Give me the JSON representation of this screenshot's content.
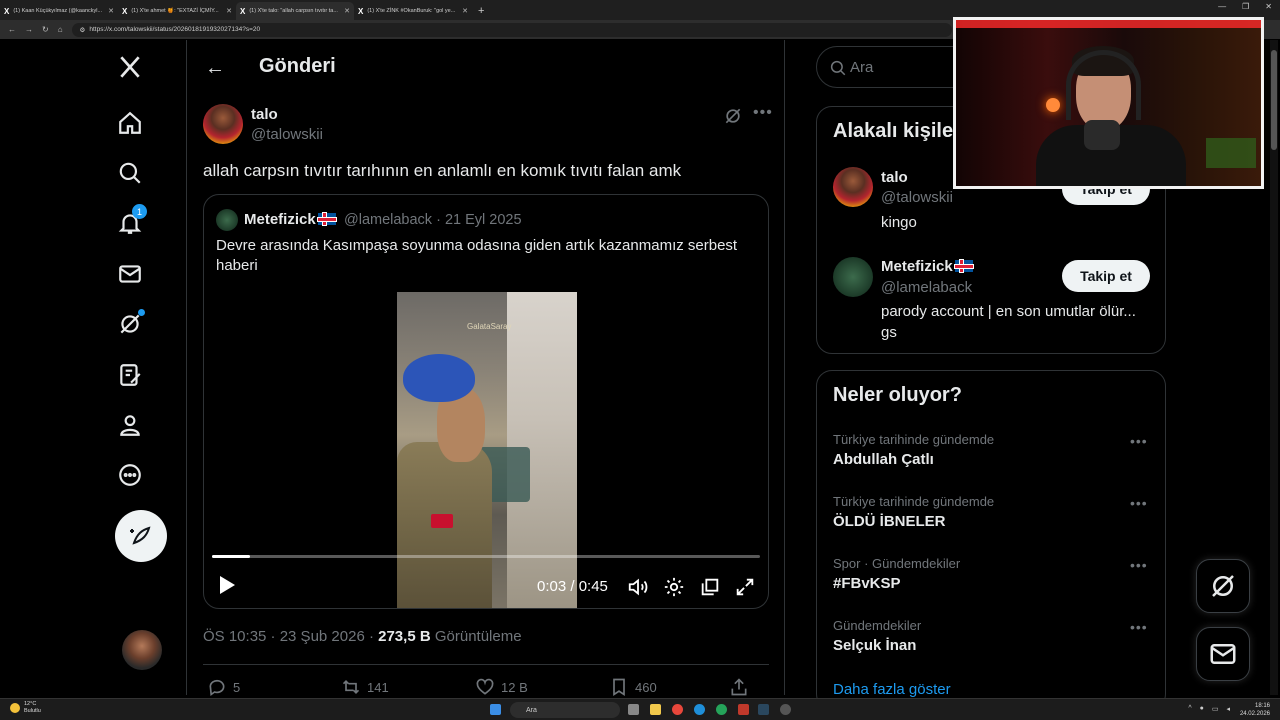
{
  "browser": {
    "tabs": [
      {
        "label": "(1) Kaan Küçükyılmaz (@kaanckyl...",
        "active": false
      },
      {
        "label": "(1) X'te ahmet 🍯: \"EXTAZİ İÇMİY...",
        "active": false
      },
      {
        "label": "(1) X'te talo: \"allah carpsın tıvıtır ta...",
        "active": true
      },
      {
        "label": "(1) X'te ZİNK #OkanBuruk: \"gol ye...",
        "active": false
      }
    ],
    "new_tab": "+",
    "url": "https://x.com/talowskii/status/2026018191932027134?s=20"
  },
  "nav": {
    "notifications_count": "1"
  },
  "header": {
    "back": "←",
    "title": "Gönderi"
  },
  "post": {
    "author_name": "talo",
    "author_handle": "@talowskii",
    "text": "allah carpsın tıvıtır tarıhının en anlamlı en komık tıvıtı falan amk",
    "timestamp": "ÖS 10:35 · 23 Şub 2026 ·",
    "views": "273,5 B",
    "views_label": "Görüntüleme",
    "replies": "5",
    "reposts": "141",
    "likes": "12 B",
    "bookmarks": "460"
  },
  "quote": {
    "author_name": "Metefizick",
    "author_handle": "@lamelaback · 21 Eyl 2025",
    "text": "Devre arasında Kasımpaşa soyunma odasına giden artık kazanmamız serbest haberi",
    "video_time": "0:03 / 0:45",
    "video_progress": 0.07,
    "video_sign": "GalataSaray"
  },
  "sidebar": {
    "search_placeholder": "Ara",
    "related_title": "Alakalı kişiler",
    "related": [
      {
        "name": "talo",
        "handle": "@talowskii",
        "bio": "kingo",
        "follow": "Takip et"
      },
      {
        "name": "Metefizick",
        "handle": "@lamelaback",
        "bio": "parody account | en son umutlar ölür... gs",
        "follow": "Takip et"
      }
    ],
    "trends_title": "Neler oluyor?",
    "trends": [
      {
        "context": "Türkiye tarihinde gündemde",
        "name": "Abdullah Çatlı"
      },
      {
        "context": "Türkiye tarihinde gündemde",
        "name": "ÖLDÜ İBNELER"
      },
      {
        "context": "Spor · Gündemdekiler",
        "name": "#FBvKSP"
      },
      {
        "context": "Gündemdekiler",
        "name": "Selçuk İnan"
      }
    ],
    "show_more": "Daha fazla göster"
  },
  "taskbar": {
    "weather_temp": "12°C",
    "weather_desc": "Bulutlu",
    "search": "Ara",
    "time": "18:16",
    "date": "24.02.2026"
  },
  "colors": {
    "accent": "#1d9bf0",
    "background": "#000000",
    "border": "#2f3336",
    "muted_text": "#71767b"
  }
}
